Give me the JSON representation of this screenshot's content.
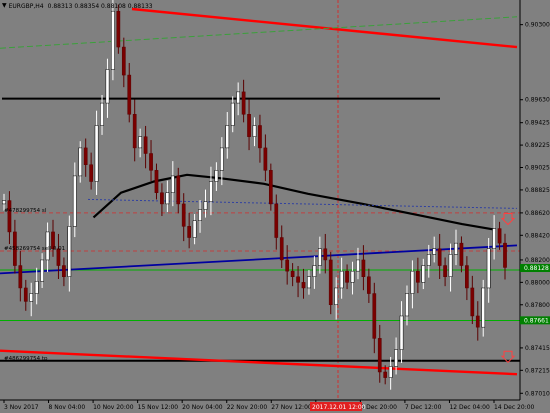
{
  "header": {
    "symbol": "EURGBP,H4",
    "ohlc": "0.88313 0.88354 0.88108 0.88133"
  },
  "colors": {
    "background": "#808080",
    "bull": "#ffffff",
    "bear": "#7a0000",
    "ma": "#000000",
    "trend_blue": "#0000a0",
    "channel_red": "#ff0000",
    "support_green": "#00b000",
    "resistance_black": "#000000"
  },
  "chart_data": {
    "type": "candlestick",
    "ylim": [
      0.8695,
      0.9052
    ],
    "y_ticks": [
      "0.90300",
      "0.89630",
      "0.89425",
      "0.89225",
      "0.89025",
      "0.88825",
      "0.88620",
      "0.88420",
      "0.88200",
      "0.88000",
      "0.87800",
      "0.87415",
      "0.87215",
      "0.87010",
      "0.86815"
    ],
    "x_ticks": [
      "3 Nov 2017",
      "8 Nov 04:00",
      "10 Nov 20:00",
      "15 Nov 12:00",
      "20 Nov 04:00",
      "22 Nov 20:00",
      "27 Nov 12:00",
      "30 Nov 04:00",
      "5 Dec 20:00",
      "7 Dec 12:00",
      "12 Dec 04:00",
      "14 Dec 20:00"
    ],
    "price_labels": [
      {
        "text": "0.88128",
        "value": 0.88128,
        "color": "#008000"
      },
      {
        "text": "0.87661",
        "value": 0.87661,
        "color": "#008000"
      }
    ],
    "time_label": "2017.12.01 12:00",
    "line_labels": [
      "#478299754 sl",
      "#458269754 sell 0.01",
      "#486299754 tp"
    ],
    "horizontal_lines": [
      {
        "name": "resistance",
        "value": 0.8964,
        "color": "#000000"
      },
      {
        "name": "support-upper",
        "value": 0.8811,
        "color": "#00b000"
      },
      {
        "name": "support-lower",
        "value": 0.8766,
        "color": "#00b000"
      },
      {
        "name": "stop-loss-level",
        "value": 0.8862,
        "color": "#c04040"
      },
      {
        "name": "order-level",
        "value": 0.8828,
        "color": "#c04040"
      },
      {
        "name": "take-profit-level",
        "value": 0.873,
        "color": "#000000"
      }
    ],
    "trendlines": [
      {
        "name": "channel-top",
        "color": "#ff0000",
        "points": [
          [
            0.24,
            0.9044
          ],
          [
            0.94,
            0.901
          ]
        ]
      },
      {
        "name": "channel-bottom",
        "color": "#ff0000",
        "points": [
          [
            0.0,
            0.8739
          ],
          [
            0.94,
            0.8718
          ]
        ]
      },
      {
        "name": "blue-trendline",
        "color": "#0000a0",
        "points": [
          [
            0.0,
            0.8808
          ],
          [
            0.94,
            0.8833
          ]
        ]
      },
      {
        "name": "moving-average",
        "color": "#000000",
        "points": [
          [
            0.17,
            0.8858
          ],
          [
            0.22,
            0.888
          ],
          [
            0.28,
            0.889
          ],
          [
            0.34,
            0.8896
          ],
          [
            0.4,
            0.8893
          ],
          [
            0.48,
            0.8888
          ],
          [
            0.56,
            0.8879
          ],
          [
            0.66,
            0.887
          ],
          [
            0.76,
            0.886
          ],
          [
            0.84,
            0.8852
          ],
          [
            0.9,
            0.8847
          ]
        ]
      },
      {
        "name": "green-dashed-line",
        "color": "#3aa03a",
        "points": [
          [
            0.0,
            0.9009
          ],
          [
            0.94,
            0.9037
          ]
        ]
      },
      {
        "name": "blue-dotted-line",
        "color": "#3040a0",
        "points": [
          [
            0.16,
            0.8874
          ],
          [
            0.94,
            0.8866
          ]
        ]
      }
    ],
    "candles_close": [
      0.8873,
      0.8845,
      0.8815,
      0.8795,
      0.8783,
      0.879,
      0.8801,
      0.882,
      0.8845,
      0.883,
      0.8815,
      0.8805,
      0.885,
      0.8895,
      0.892,
      0.8905,
      0.889,
      0.894,
      0.896,
      0.899,
      0.9042,
      0.901,
      0.8985,
      0.895,
      0.892,
      0.893,
      0.8915,
      0.89,
      0.888,
      0.887,
      0.888,
      0.8895,
      0.887,
      0.885,
      0.884,
      0.8855,
      0.8865,
      0.8872,
      0.889,
      0.89,
      0.892,
      0.894,
      0.896,
      0.897,
      0.895,
      0.893,
      0.894,
      0.892,
      0.89,
      0.887,
      0.884,
      0.882,
      0.881,
      0.8805,
      0.88,
      0.8795,
      0.8805,
      0.8815,
      0.883,
      0.882,
      0.878,
      0.8795,
      0.881,
      0.88,
      0.881,
      0.882,
      0.8805,
      0.879,
      0.875,
      0.872,
      0.8715,
      0.8725,
      0.874,
      0.877,
      0.879,
      0.881,
      0.88,
      0.8815,
      0.8825,
      0.883,
      0.8815,
      0.8805,
      0.8825,
      0.8835,
      0.8815,
      0.8795,
      0.877,
      0.876,
      0.8795,
      0.883,
      0.8848,
      0.8835,
      0.88133
    ],
    "arrows": [
      {
        "value": 0.8857,
        "color": "#ff4040"
      },
      {
        "value": 0.8734,
        "color": "#ff4040"
      }
    ]
  }
}
